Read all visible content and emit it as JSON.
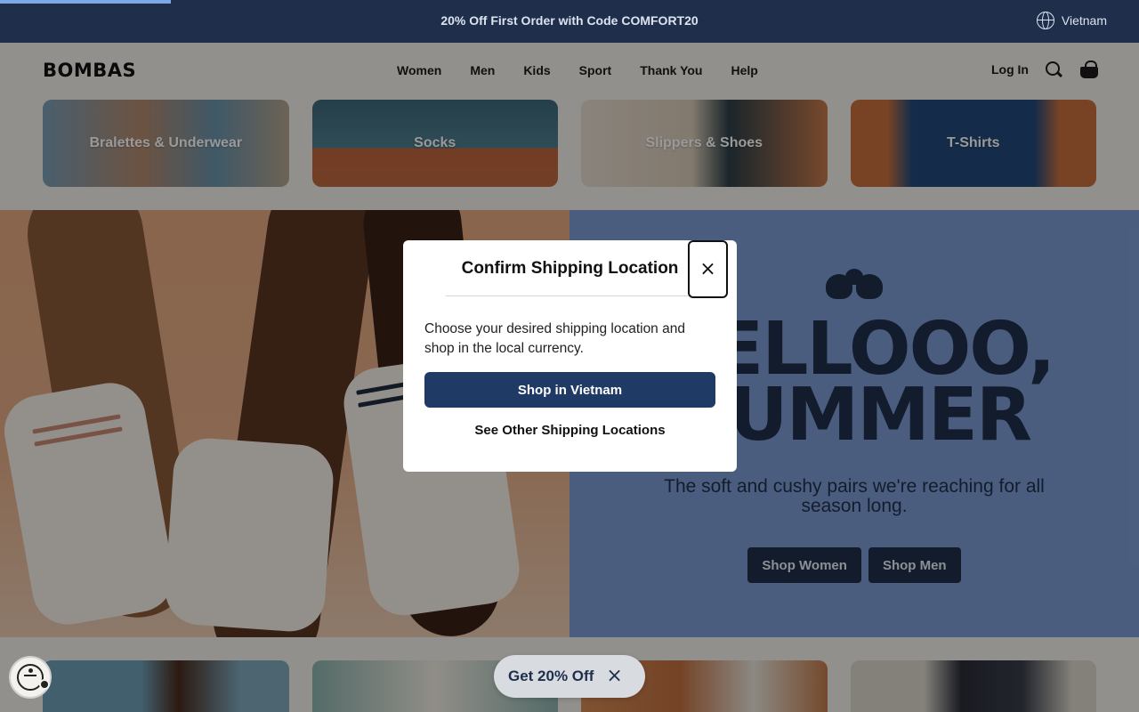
{
  "announcement": {
    "promo_text": "20% Off First Order with Code COMFORT20",
    "region_label": "Vietnam"
  },
  "header": {
    "logo": "BOMBAS",
    "nav": [
      "Women",
      "Men",
      "Kids",
      "Sport",
      "Thank You",
      "Help"
    ],
    "login_label": "Log In"
  },
  "categories": [
    "Bralettes & Underwear",
    "Socks",
    "Slippers & Shoes",
    "T-Shirts"
  ],
  "hero": {
    "headline_line1": "HELLOOO,",
    "headline_line2": "SUMMER",
    "subtitle": "The soft and cushy pairs we're reaching for all season long.",
    "shop_women": "Shop Women",
    "shop_men": "Shop Men"
  },
  "modal": {
    "title": "Confirm Shipping Location",
    "close_glyph": "×",
    "body": "Choose your desired shipping location and shop in the local currency.",
    "primary_button": "Shop in Vietnam",
    "secondary_link": "See Other Shipping Locations"
  },
  "promo_pill": {
    "label": "Get 20% Off",
    "close_glyph": "×"
  },
  "colors": {
    "navy": "#1f2f4b",
    "hero_blue": "#7d9cd3",
    "hero_peach": "#e5a880",
    "button_navy": "#1f3a64"
  }
}
